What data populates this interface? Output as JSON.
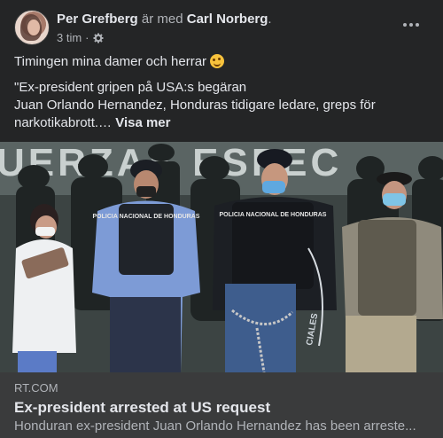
{
  "post": {
    "author": "Per Grefberg",
    "with_text": "är med",
    "tagged": "Carl Norberg",
    "tagged_suffix": ".",
    "time": "3 tim",
    "time_sep": "·",
    "privacy_icon": "gear-icon",
    "more_icon": "more-options-icon",
    "text_line1": "Timingen mina damer och herrar",
    "emoji": "smiling-face-emoji",
    "text_line2": "\"Ex-president gripen på USA:s begäran",
    "text_line3": "Juan Orlando Hernandez, Honduras tidigare ledare, greps för",
    "text_line4": "narkotikabrott.…",
    "see_more": "Visa mer"
  },
  "photo": {
    "wall_text": "UERZAS ESPEC",
    "badge_police": "POLICIA NACIONAL DE HONDURAS",
    "badge_police2": "POLICIA NACIONAL DE HONDURAS",
    "side_text": "CIALES"
  },
  "link": {
    "domain": "RT.COM",
    "title": "Ex-president arrested at US request",
    "description": "Honduran ex-president Juan Orlando Hernandez has been arreste..."
  }
}
